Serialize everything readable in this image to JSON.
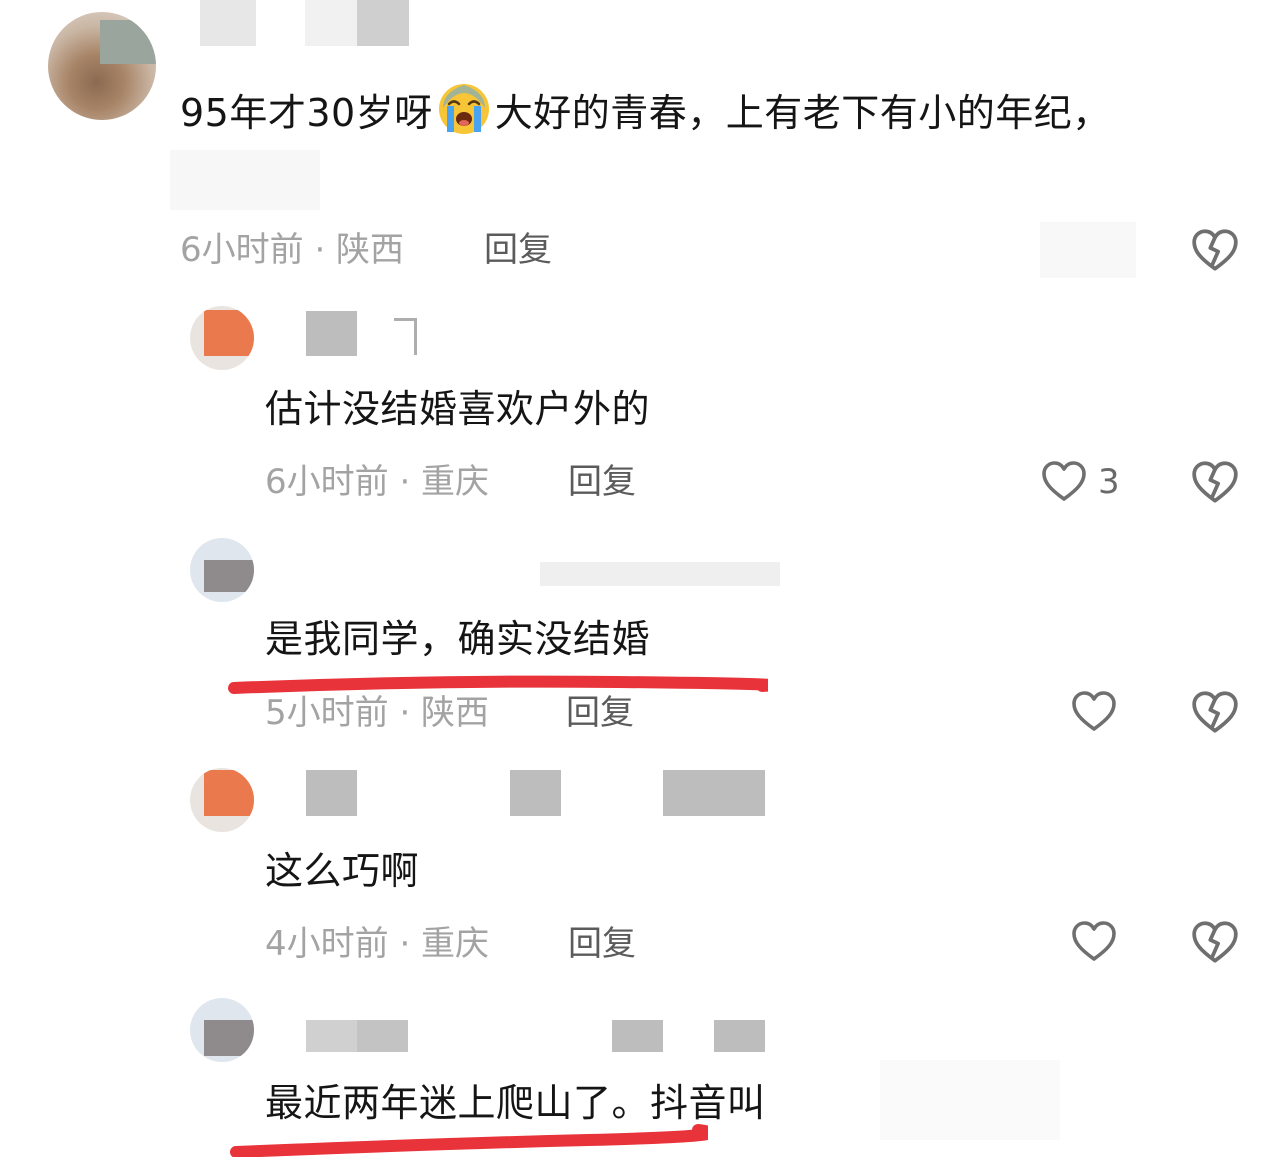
{
  "comments": [
    {
      "text_part1": "95年才30岁呀",
      "emoji": "loudly-crying-face-emoji",
      "text_part2": "大好的青春，上有老下有小的年纪，",
      "time": "6小时前 · 陕西",
      "reply_label": "回复"
    },
    {
      "text": "估计没结婚喜欢户外的",
      "time": "6小时前 · 重庆",
      "reply_label": "回复",
      "like_count": "3"
    },
    {
      "text": "是我同学，确实没结婚",
      "time": "5小时前 · 陕西",
      "reply_label": "回复"
    },
    {
      "text": "这么巧啊",
      "time": "4小时前 · 重庆",
      "reply_label": "回复"
    },
    {
      "text": "最近两年迷上爬山了。抖音叫"
    }
  ],
  "icons": {
    "like": "heart-outline-icon",
    "dislike": "broken-heart-icon"
  },
  "colors": {
    "underline": "#e8333a",
    "meta_text": "#a3a3a3",
    "reply_text": "#5b5b5b"
  }
}
